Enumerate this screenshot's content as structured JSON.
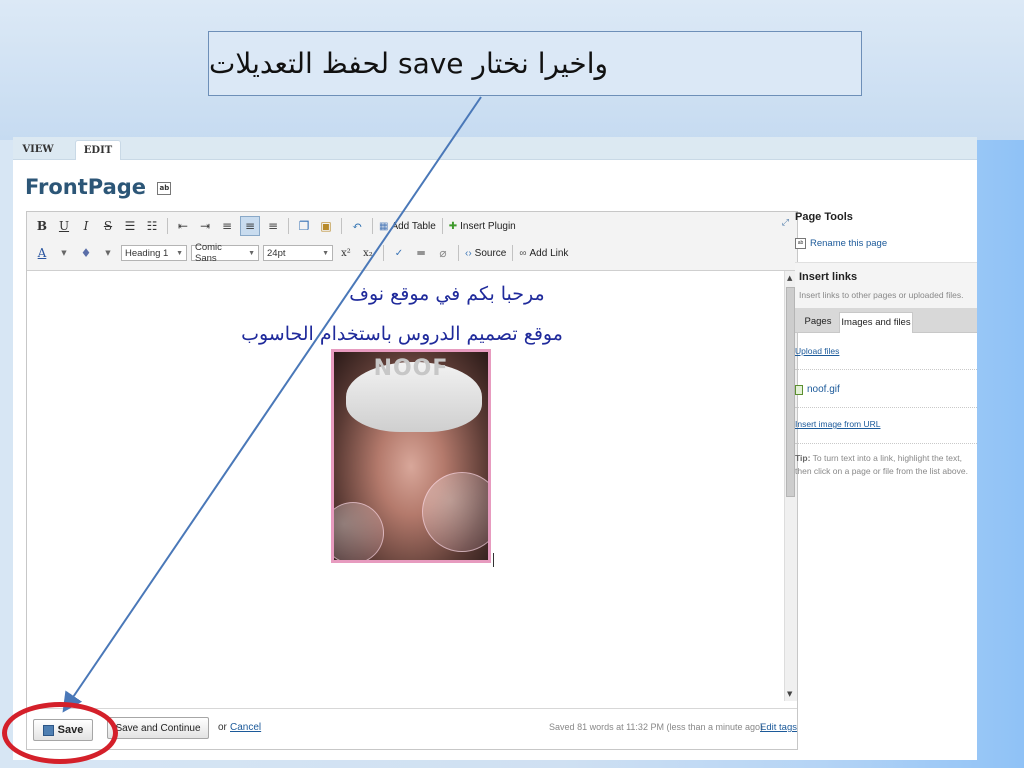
{
  "callout": {
    "text": "واخيرا نختار save لحفظ التعديلات"
  },
  "tabs": {
    "view": "VIEW",
    "edit": "EDIT"
  },
  "page": {
    "title": "FrontPage"
  },
  "toolbar": {
    "bold": "B",
    "underline": "U",
    "italic": "I",
    "strike": "S",
    "add_table": "Add Table",
    "insert_plugin": "Insert Plugin",
    "format_value": "Heading 1",
    "font_value": "Comic Sans",
    "size_value": "24pt",
    "superscript": "x²",
    "subscript": "x₂",
    "source": "Source",
    "add_link": "Add Link"
  },
  "content": {
    "line1": "مرحبا بكم في موقع نوف",
    "line2": "موقع تصميم الدروس باستخدام الحاسوب",
    "image_text": "NOOF"
  },
  "bottom": {
    "save": "Save",
    "save_continue": "Save and Continue",
    "or": "or",
    "cancel": "Cancel",
    "status": "Saved 81 words at 11:32 PM (less than a minute ago)",
    "edit_tags": "Edit tags"
  },
  "sidebar": {
    "heading": "Page Tools",
    "rename": "Rename this page",
    "insert_title": "Insert links",
    "insert_sub": "Insert links to other pages or uploaded files.",
    "tab_pages": "Pages",
    "tab_images": "Images and files",
    "upload": "Upload files",
    "file": "noof.gif",
    "insert_url": "Insert image from URL",
    "tip_label": "Tip:",
    "tip_text": "To turn text into a link, highlight the text, then click on a page or file from the list above."
  },
  "colors": {
    "annotation_ring": "#d4202a",
    "arrow": "#4a78b8",
    "link": "#1c5a9a",
    "title": "#2c5677"
  }
}
